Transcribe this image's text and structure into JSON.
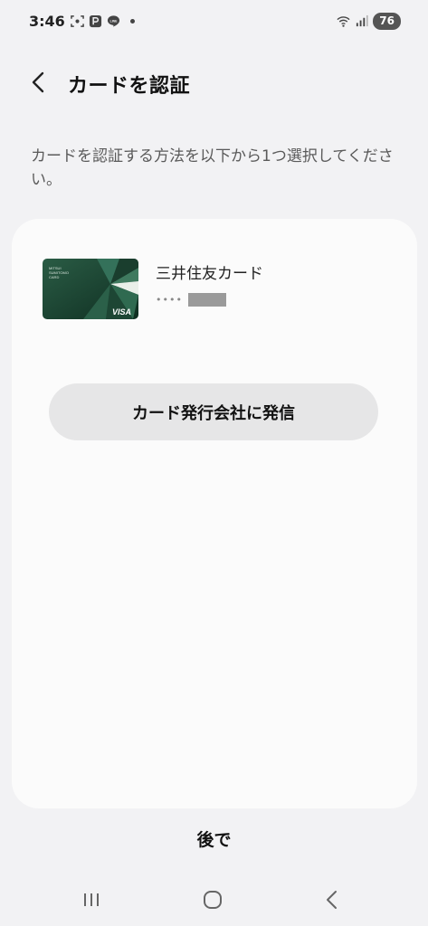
{
  "status_bar": {
    "time": "3:46",
    "battery": "76",
    "icons": [
      "screenshot-icon",
      "p-app-icon",
      "line-icon",
      "notification-dot-icon",
      "wifi-icon",
      "signal-icon",
      "battery-icon"
    ],
    "line_label": "LINE"
  },
  "header": {
    "back_icon": "chevron-left-icon",
    "title": "カードを認証"
  },
  "instruction": "カードを認証する方法を以下から1つ選択してください。",
  "card": {
    "name": "三井住友カード",
    "number_prefix": "••••",
    "image": {
      "brand_text": "MITSUI SUMITOMO CARD",
      "network": "VISA",
      "color": "#1f4a37"
    }
  },
  "actions": {
    "contact_issuer": "カード発行会社に発信",
    "later": "後で"
  },
  "nav_bar": {
    "icons": [
      "recent-apps-icon",
      "home-icon",
      "back-icon"
    ]
  },
  "colors": {
    "background": "#f2f2f4",
    "panel": "#fbfbfb",
    "button": "#e6e6e7",
    "instruction_text": "#5a5a5a"
  }
}
